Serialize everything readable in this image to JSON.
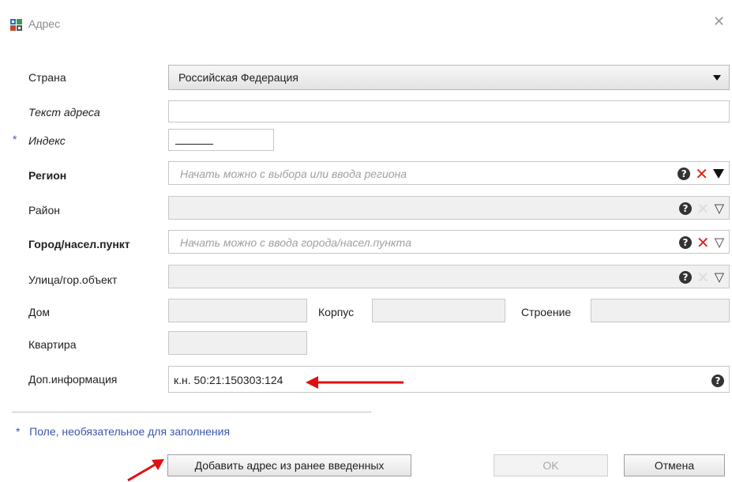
{
  "window": {
    "title": "Адрес"
  },
  "form": {
    "country": {
      "label": "Страна",
      "value": "Российская Федерация"
    },
    "address_text": {
      "label": "Текст адреса",
      "value": ""
    },
    "index": {
      "required_mark": "*",
      "label": "Индекс",
      "value": ""
    },
    "region": {
      "label": "Регион",
      "placeholder": "Начать можно с выбора или ввода региона"
    },
    "district": {
      "label": "Район",
      "value": ""
    },
    "city": {
      "label": "Город/насел.пункт",
      "placeholder": "Начать можно с ввода города/насел.пункта"
    },
    "street": {
      "label": "Улица/гор.объект",
      "value": ""
    },
    "house": {
      "label": "Дом",
      "value": ""
    },
    "building": {
      "label": "Корпус",
      "value": ""
    },
    "structure": {
      "label": "Строение",
      "value": ""
    },
    "apartment": {
      "label": "Квартира",
      "value": ""
    },
    "extra_info": {
      "label": "Доп.информация",
      "value": "к.н. 50:21:150303:124"
    }
  },
  "icons": {
    "help": "?",
    "clear": "✕",
    "dropdown_filled": "▼",
    "dropdown_outline": "▽",
    "close": "✕"
  },
  "footer": {
    "note_star": "*",
    "note": "Поле, необязательное для заполнения",
    "add_from_previous": "Добавить адрес из ранее введенных",
    "ok": "OK",
    "cancel": "Отмена"
  },
  "colors": {
    "accent_red": "#d8261c",
    "note_blue": "#3a56b0",
    "arrow_red": "#e01010"
  }
}
